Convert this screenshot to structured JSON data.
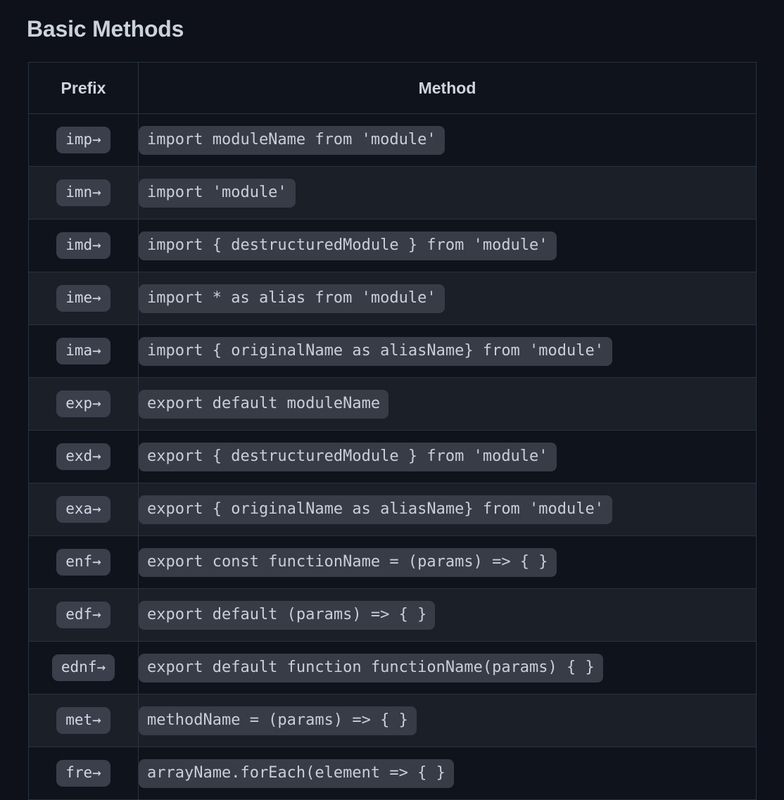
{
  "page": {
    "title": "Basic Methods",
    "background_color": "#0e1119",
    "accent_colors": {
      "badge_bg": "#3a3f4b",
      "code_bg": "#373c47",
      "border": "#2b3140",
      "row_dark": "#0f131b",
      "row_light": "#1b1f28",
      "text": "#c9ced8",
      "heading_text": "#ccd2dc"
    }
  },
  "table": {
    "columns": [
      {
        "key": "prefix",
        "label": "Prefix"
      },
      {
        "key": "method",
        "label": "Method"
      }
    ],
    "rows": [
      {
        "prefix": "imp→",
        "method": "import moduleName from 'module'"
      },
      {
        "prefix": "imn→",
        "method": "import 'module'"
      },
      {
        "prefix": "imd→",
        "method": "import { destructuredModule } from 'module'"
      },
      {
        "prefix": "ime→",
        "method": "import * as alias from 'module'"
      },
      {
        "prefix": "ima→",
        "method": "import { originalName as aliasName} from 'module'"
      },
      {
        "prefix": "exp→",
        "method": "export default moduleName"
      },
      {
        "prefix": "exd→",
        "method": "export { destructuredModule } from 'module'"
      },
      {
        "prefix": "exa→",
        "method": "export { originalName as aliasName} from 'module'"
      },
      {
        "prefix": "enf→",
        "method": "export const functionName = (params) => { }"
      },
      {
        "prefix": "edf→",
        "method": "export default (params) => { }"
      },
      {
        "prefix": "ednf→",
        "method": "export default function functionName(params) { }"
      },
      {
        "prefix": "met→",
        "method": "methodName = (params) => { }"
      },
      {
        "prefix": "fre→",
        "method": "arrayName.forEach(element => { }"
      }
    ]
  }
}
